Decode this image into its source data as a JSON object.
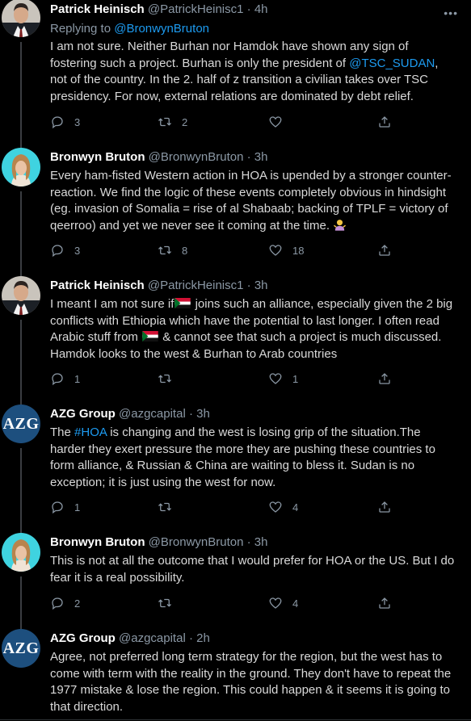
{
  "tweets": [
    {
      "name": "Patrick Heinisch",
      "handle": "@PatrickHeinisc1",
      "time": "4h",
      "avatar": "patrick",
      "replying_prefix": "Replying to",
      "replying_to": "@BronwynBruton",
      "text": {
        "p1": "I am not sure. Neither Burhan nor Hamdok have shown any sign of fostering such a project. Burhan is only the president of ",
        "mention": "@TSC_SUDAN",
        "p2": ", not of the country. In the 2. half of z transition a civilian takes over TSC presidency. For now, external relations are dominated by debt relief."
      },
      "replies": "3",
      "retweets": "2",
      "likes": ""
    },
    {
      "name": "Bronwyn Bruton",
      "handle": "@BronwynBruton",
      "time": "3h",
      "avatar": "bronwyn",
      "text": "Every ham-fisted Western action in HOA is upended by a stronger counter-reaction. We find the logic of these events completely obvious in hindsight (eg. invasion of Somalia = rise of al Shabaab; backing of TPLF = victory of qeerroo) and yet we never see it coming at the time. ",
      "emoji": "person-shrugging",
      "replies": "3",
      "retweets": "8",
      "likes": "18"
    },
    {
      "name": "Patrick Heinisch",
      "handle": "@PatrickHeinisc1",
      "time": "3h",
      "avatar": "patrick",
      "text": {
        "p1": "I meant I am not sure if",
        "p2": " joins such an alliance, especially given the 2 big conflicts with Ethiopia which have the potential to last longer. I often read Arabic stuff from ",
        "p3": " & cannot see that such a project is much discussed. Hamdok looks to the west & Burhan to Arab countries"
      },
      "flag": "sudan-flag",
      "replies": "1",
      "retweets": "",
      "likes": "1"
    },
    {
      "name": "AZG Group",
      "handle": "@azgcapital",
      "time": "3h",
      "avatar": "azg",
      "avatar_text": "AZG",
      "text": {
        "p0": "The ",
        "hashtag": "#HOA",
        "p1": " is changing and the west is losing grip of the situation.The harder they exert pressure the more they are pushing these countries to form alliance, & Russian & China are waiting to bless it. Sudan is no exception; it is just using the west for now."
      },
      "replies": "1",
      "retweets": "",
      "likes": "4"
    },
    {
      "name": "Bronwyn Bruton",
      "handle": "@BronwynBruton",
      "time": "3h",
      "avatar": "bronwyn",
      "text": "This is not at all the outcome that I would prefer for HOA or the US. But I do fear it is a real possibility.",
      "replies": "2",
      "retweets": "",
      "likes": "4"
    },
    {
      "name": "AZG Group",
      "handle": "@azgcapital",
      "time": "2h",
      "avatar": "azg",
      "avatar_text": "AZG",
      "text": "Agree, not preferred long term strategy for the region, but the west has to come with term with the reality in the ground. They don't have to repeat the 1977 mistake & lose the region. This could happen & it seems it is going to that direction."
    }
  ],
  "separator": "·",
  "colors": {
    "background": "#000000",
    "link": "#1d9bf0",
    "muted": "#8b98a5",
    "azg_avatar": "#1d4f7e"
  }
}
